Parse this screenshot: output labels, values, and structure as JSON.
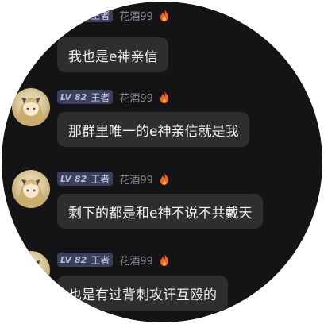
{
  "messages": [
    {
      "level_prefix": "LV",
      "level": "82",
      "rank": "王者",
      "username": "花酒99",
      "text": "我也是e神亲信"
    },
    {
      "level_prefix": "LV",
      "level": "82",
      "rank": "王者",
      "username": "花酒99",
      "text": "那群里唯一的e神亲信就是我"
    },
    {
      "level_prefix": "LV",
      "level": "82",
      "rank": "王者",
      "username": "花酒99",
      "text": "剩下的都是和e神不说不共戴天"
    },
    {
      "level_prefix": "LV",
      "level": "82",
      "rank": "王者",
      "username": "花酒99",
      "text": "也是有过背刺攻讦互殴的"
    }
  ],
  "icons": {
    "badge": "fire-icon",
    "avatar": "anime-avatar"
  },
  "colors": {
    "background": "#141416",
    "bubble": "#2e2e31",
    "level_badge": "#3b3f5a",
    "fire": "#ff5a1f"
  }
}
